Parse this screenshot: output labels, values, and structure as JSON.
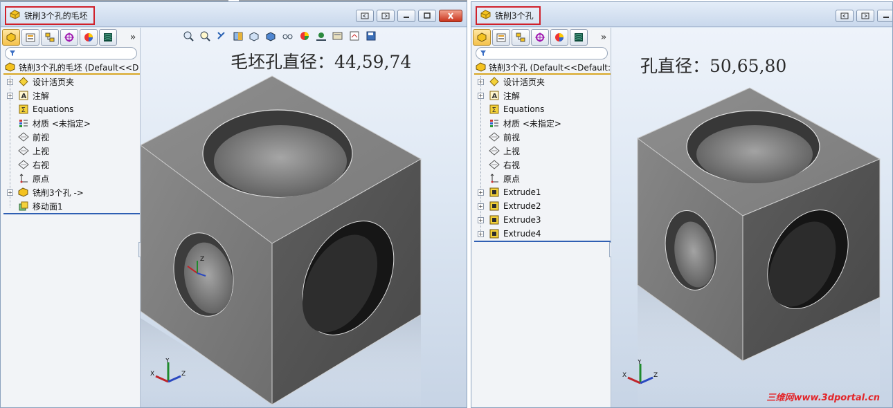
{
  "left_window": {
    "title": "铣削3个孔的毛坯",
    "root_label": "铣削3个孔的毛坯 (Default<<D",
    "annotation": "毛坯孔直径：44,59,74",
    "tree": [
      {
        "label": "设计活页夹",
        "icon": "binder-icon",
        "expandable": true
      },
      {
        "label": "注解",
        "icon": "annotation-icon",
        "expandable": true
      },
      {
        "label": "Equations",
        "icon": "equations-icon",
        "expandable": false
      },
      {
        "label": "材质 <未指定>",
        "icon": "material-icon",
        "expandable": false
      },
      {
        "label": "前视",
        "icon": "plane-icon",
        "expandable": false
      },
      {
        "label": "上视",
        "icon": "plane-icon",
        "expandable": false
      },
      {
        "label": "右视",
        "icon": "plane-icon",
        "expandable": false
      },
      {
        "label": "原点",
        "icon": "origin-icon",
        "expandable": false
      },
      {
        "label": "铣削3个孔 ->",
        "icon": "part-icon",
        "expandable": true
      },
      {
        "label": "移动面1",
        "icon": "move-face-icon",
        "expandable": false
      }
    ]
  },
  "right_window": {
    "title": "铣削3个孔",
    "root_label": "铣削3个孔 (Default<<Default:",
    "annotation": "孔直径：50,65,80",
    "tree": [
      {
        "label": "设计活页夹",
        "icon": "binder-icon",
        "expandable": true
      },
      {
        "label": "注解",
        "icon": "annotation-icon",
        "expandable": true
      },
      {
        "label": "Equations",
        "icon": "equations-icon",
        "expandable": false
      },
      {
        "label": "材质 <未指定>",
        "icon": "material-icon",
        "expandable": false
      },
      {
        "label": "前视",
        "icon": "plane-icon",
        "expandable": false
      },
      {
        "label": "上视",
        "icon": "plane-icon",
        "expandable": false
      },
      {
        "label": "右视",
        "icon": "plane-icon",
        "expandable": false
      },
      {
        "label": "原点",
        "icon": "origin-icon",
        "expandable": false
      },
      {
        "label": "Extrude1",
        "icon": "extrude-icon",
        "expandable": true
      },
      {
        "label": "Extrude2",
        "icon": "extrude-icon",
        "expandable": true
      },
      {
        "label": "Extrude3",
        "icon": "extrude-icon",
        "expandable": true
      },
      {
        "label": "Extrude4",
        "icon": "extrude-icon",
        "expandable": true
      }
    ],
    "watermark": "三维网www.3dportal.cn"
  },
  "manager_tabs": [
    "feature-manager-icon",
    "property-manager-icon",
    "configuration-manager-icon",
    "dimxpert-icon",
    "display-manager-icon",
    "sketch-ink-icon"
  ],
  "more_tabs_glyph": "»",
  "triad_labels": {
    "x": "X",
    "y": "Y",
    "z": "Z"
  },
  "colors": {
    "title_highlight": "#d0202a",
    "tree_end_line": "#2f5fb3",
    "root_underline": "#d8a623",
    "watermark": "#e3262a"
  }
}
